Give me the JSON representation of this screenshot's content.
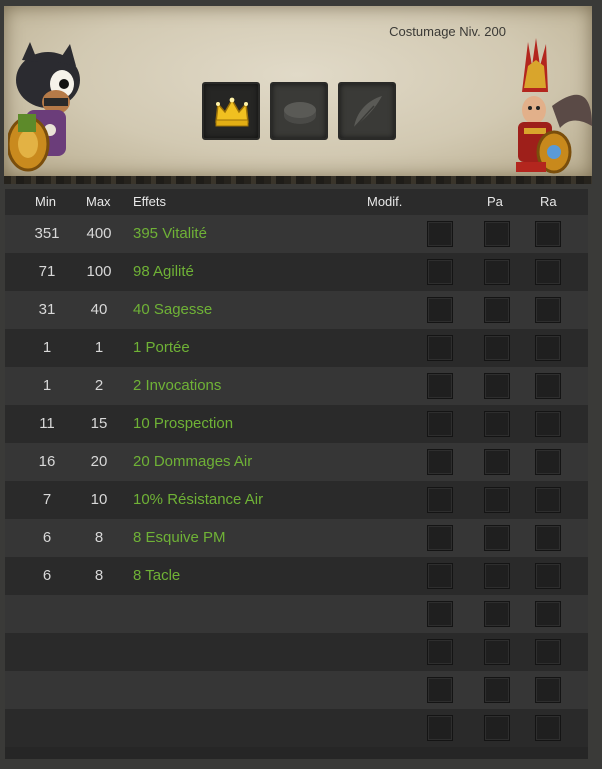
{
  "header": {
    "title": "Costumage Niv. 200",
    "slots": [
      {
        "name": "crown-slot",
        "icon": "crown-icon",
        "active": true
      },
      {
        "name": "ring-slot",
        "icon": "ring-icon",
        "active": false
      },
      {
        "name": "feather-slot",
        "icon": "feather-icon",
        "active": false
      }
    ]
  },
  "columns": {
    "min": "Min",
    "max": "Max",
    "effects": "Effets",
    "modif": "Modif.",
    "pa": "Pa",
    "ra": "Ra"
  },
  "rows": [
    {
      "min": "351",
      "max": "400",
      "effect": "395 Vitalité"
    },
    {
      "min": "71",
      "max": "100",
      "effect": "98 Agilité"
    },
    {
      "min": "31",
      "max": "40",
      "effect": "40 Sagesse"
    },
    {
      "min": "1",
      "max": "1",
      "effect": "1 Portée"
    },
    {
      "min": "1",
      "max": "2",
      "effect": "2 Invocations"
    },
    {
      "min": "11",
      "max": "15",
      "effect": "10 Prospection"
    },
    {
      "min": "16",
      "max": "20",
      "effect": "20 Dommages Air"
    },
    {
      "min": "7",
      "max": "10",
      "effect": "10% Résistance Air"
    },
    {
      "min": "6",
      "max": "8",
      "effect": "8 Esquive PM"
    },
    {
      "min": "6",
      "max": "8",
      "effect": "8 Tacle"
    },
    {
      "min": "",
      "max": "",
      "effect": ""
    },
    {
      "min": "",
      "max": "",
      "effect": ""
    },
    {
      "min": "",
      "max": "",
      "effect": ""
    },
    {
      "min": "",
      "max": "",
      "effect": ""
    }
  ],
  "colors": {
    "effect_text": "#6fb236",
    "parchment": "#d8d0bb",
    "row_light": "#363636",
    "row_dark": "#2a2a2a"
  }
}
